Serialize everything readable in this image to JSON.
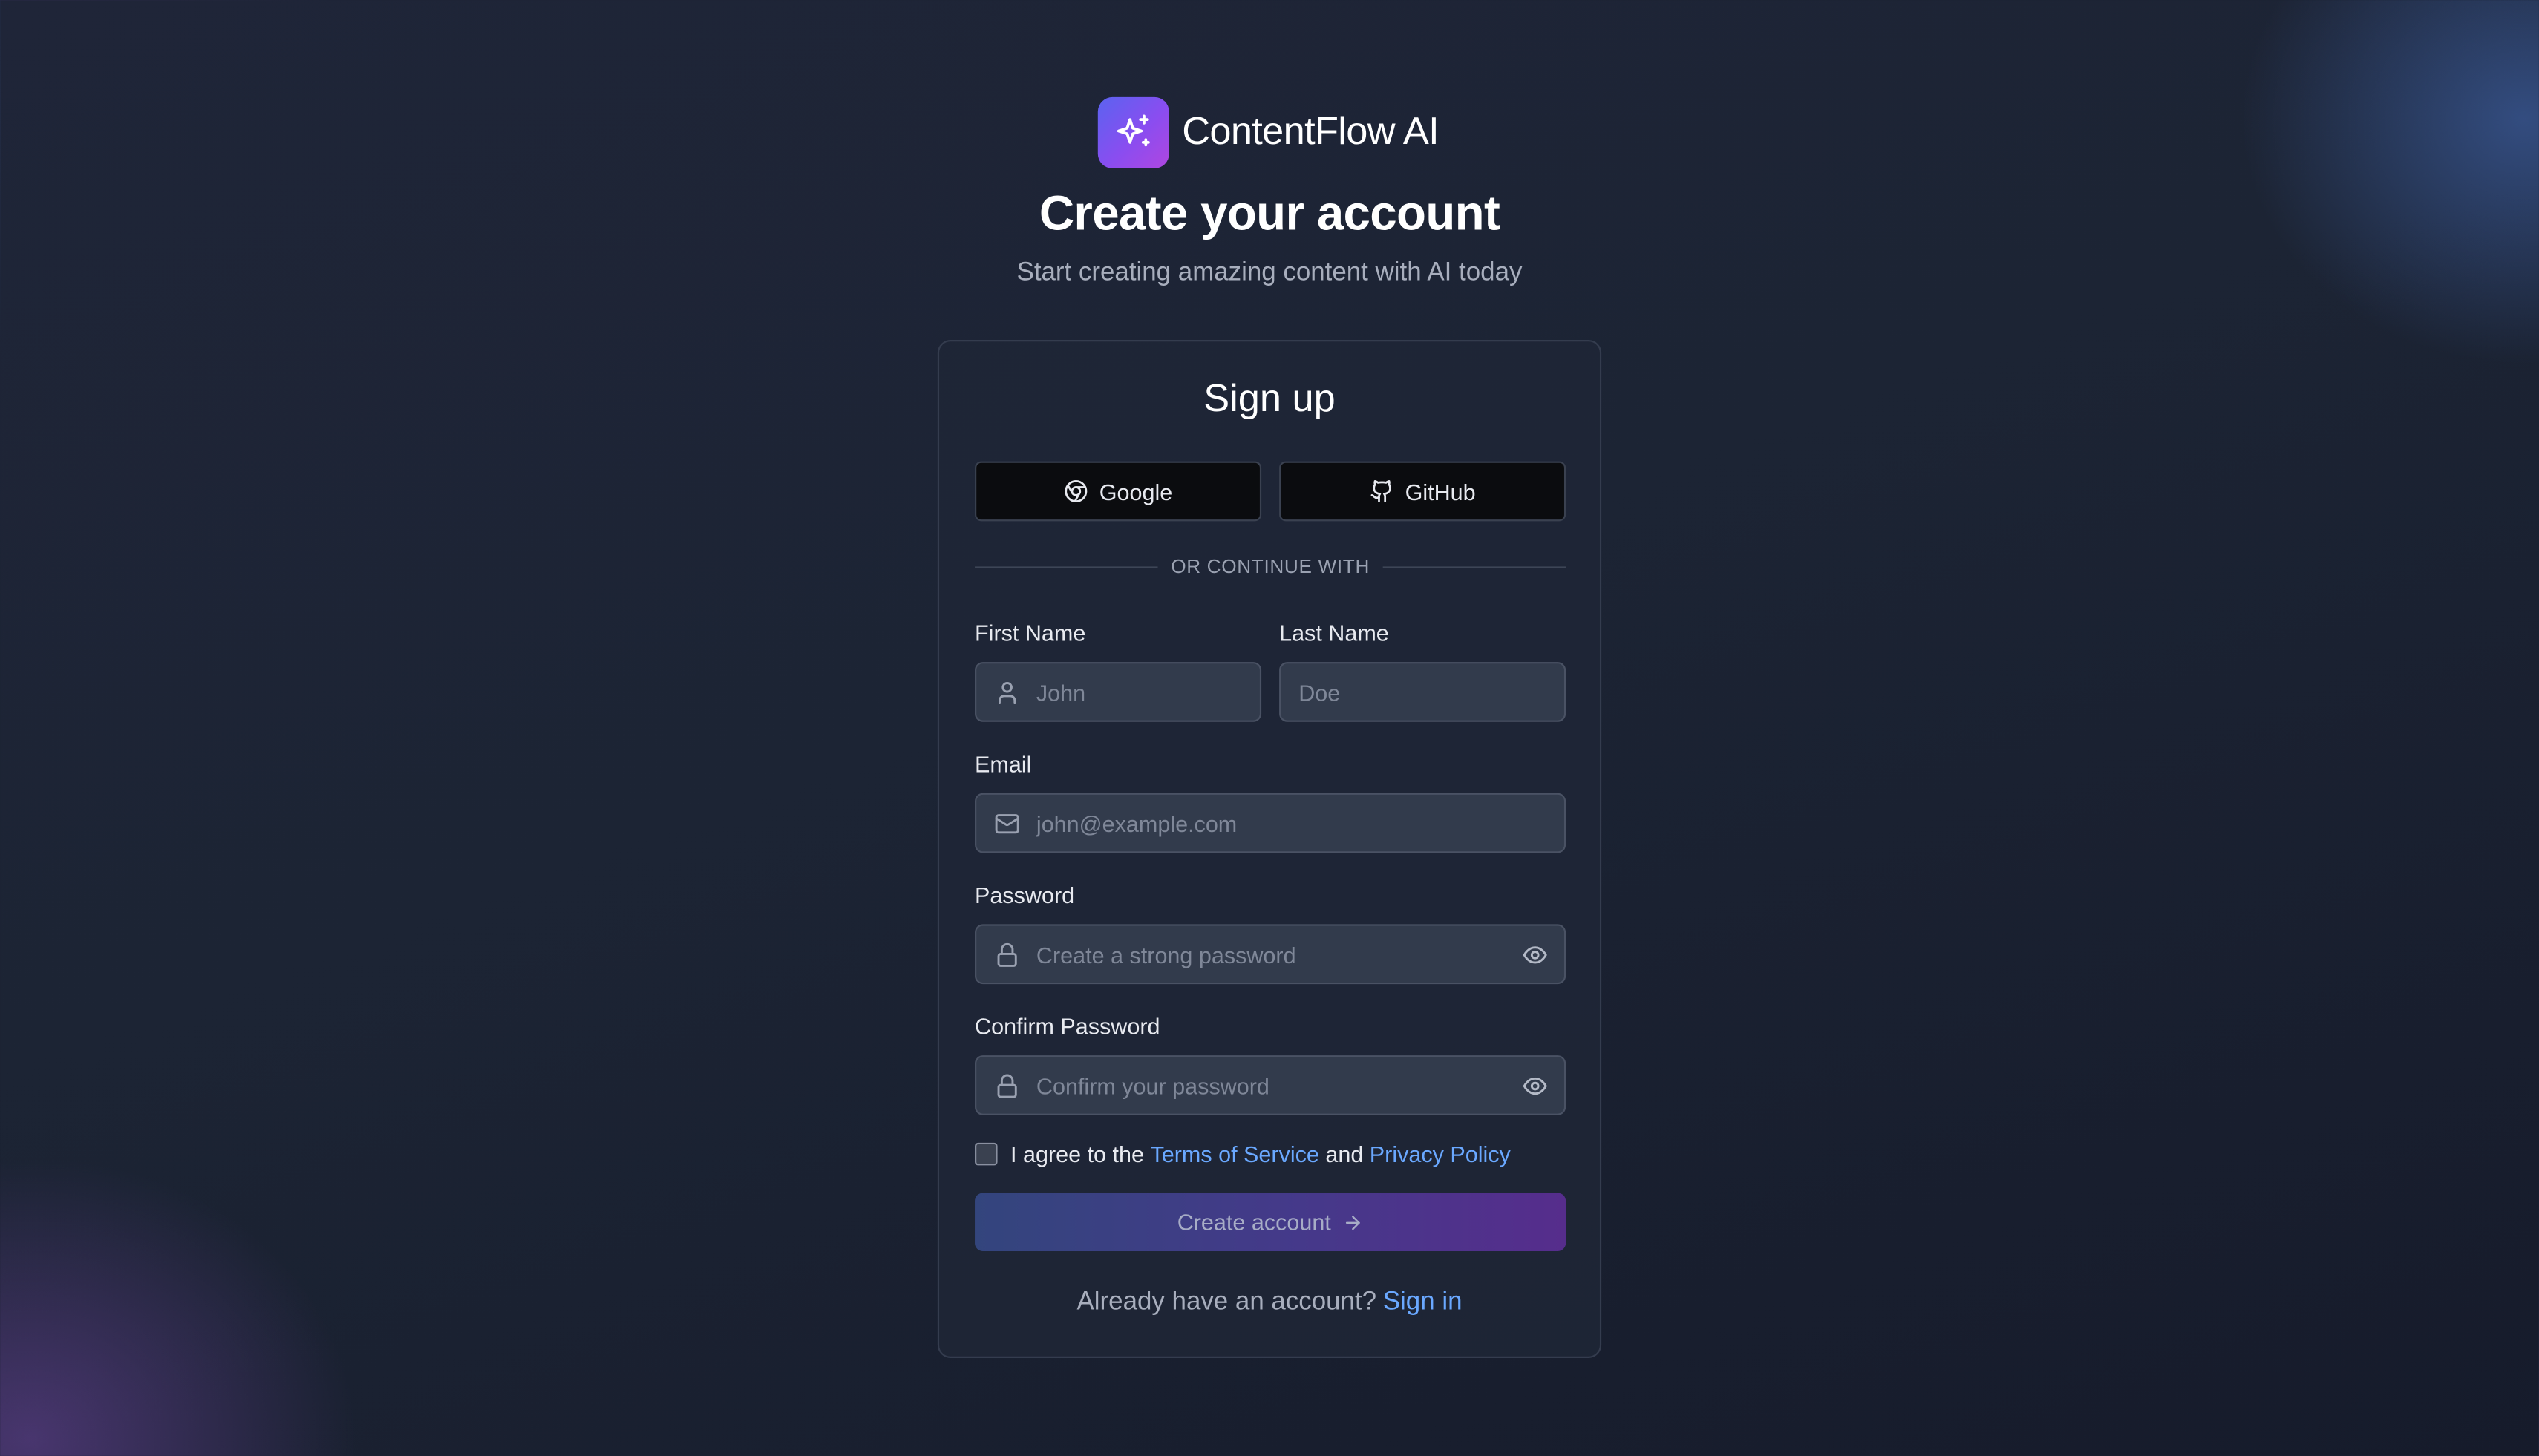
{
  "brand": {
    "name": "ContentFlow AI",
    "logo_icon": "sparkles-icon"
  },
  "header": {
    "title": "Create your account",
    "subtitle": "Start creating amazing content with AI today"
  },
  "card": {
    "title": "Sign up",
    "oauth": {
      "google": {
        "label": "Google",
        "icon": "chrome-icon"
      },
      "github": {
        "label": "GitHub",
        "icon": "github-icon"
      }
    },
    "divider_text": "OR CONTINUE WITH",
    "fields": {
      "first_name": {
        "label": "First Name",
        "placeholder": "John",
        "value": "",
        "icon": "user-icon"
      },
      "last_name": {
        "label": "Last Name",
        "placeholder": "Doe",
        "value": ""
      },
      "email": {
        "label": "Email",
        "placeholder": "john@example.com",
        "value": "",
        "icon": "mail-icon"
      },
      "password": {
        "label": "Password",
        "placeholder": "Create a strong password",
        "value": "",
        "icon": "lock-icon",
        "toggle_icon": "eye-icon"
      },
      "confirm_password": {
        "label": "Confirm Password",
        "placeholder": "Confirm your password",
        "value": "",
        "icon": "lock-icon",
        "toggle_icon": "eye-icon"
      }
    },
    "agree": {
      "prefix": "I agree to the",
      "terms": "Terms of Service",
      "and": "and",
      "privacy": "Privacy Policy",
      "checked": false
    },
    "submit": {
      "label": "Create account",
      "icon": "arrow-right-icon"
    },
    "footer": {
      "text": "Already have an account?",
      "link": "Sign in"
    }
  },
  "colors": {
    "accent_link": "#6aa8ff",
    "logo_gradient_start": "#5b63f0",
    "logo_gradient_end": "#b046e0",
    "button_gradient_start": "#33457d",
    "button_gradient_end": "#562d8c"
  }
}
